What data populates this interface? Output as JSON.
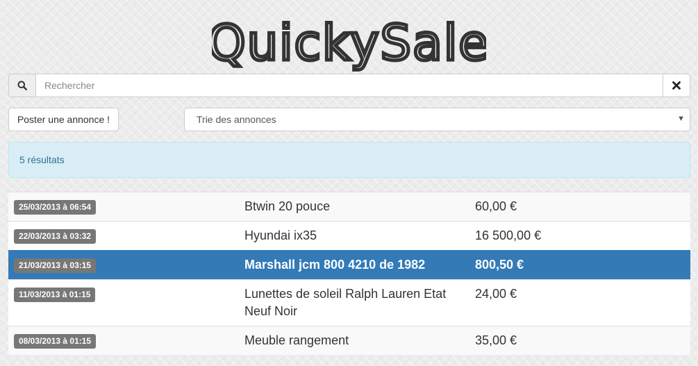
{
  "header": {
    "logo_text": "QuickySale"
  },
  "search": {
    "placeholder": "Rechercher",
    "value": "",
    "icon": "search-icon",
    "clear_icon": "close-icon"
  },
  "toolbar": {
    "post_label": "Poster une annonce !",
    "sort_selected": "Trie des annonces"
  },
  "results": {
    "count_text": "5 résultats"
  },
  "listings": [
    {
      "date": "25/03/2013 à 06:54",
      "title": "Btwin 20 pouce",
      "price": "60,00 €"
    },
    {
      "date": "22/03/2013 à 03:32",
      "title": "Hyundai ix35",
      "price": "16 500,00 €"
    },
    {
      "date": "21/03/2013 à 03:15",
      "title": "Marshall jcm 800 4210 de 1982",
      "price": "800,50 €",
      "active": true
    },
    {
      "date": "11/03/2013 à 01:15",
      "title": "Lunettes de soleil Ralph Lauren Etat Neuf Noir",
      "price": "24,00 €"
    },
    {
      "date": "08/03/2013 à 01:15",
      "title": "Meuble rangement",
      "price": "35,00 €"
    }
  ],
  "colors": {
    "accent": "#337ab7",
    "info_bg": "#d9edf7",
    "info_text": "#31708f",
    "badge": "#777777"
  }
}
